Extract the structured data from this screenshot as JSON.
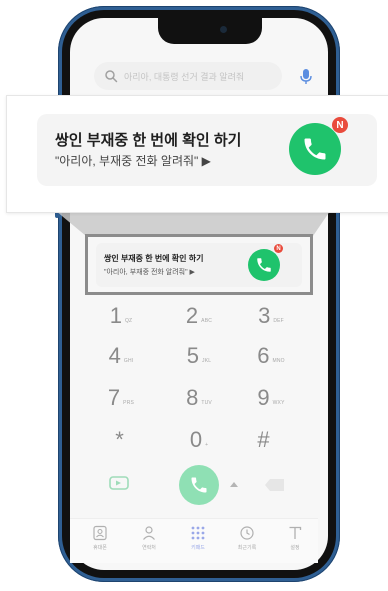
{
  "search": {
    "placeholder": "아리아, 대통령 선거 결과 알려줘"
  },
  "callout": {
    "title": "쌍인 부재중 한 번에 확인 하기",
    "subtitle": "\"아리아, 부재중 전화 알려줘\" ▶",
    "badge": "N"
  },
  "banner": {
    "title": "쌍인 부재중 한 번에 확인 하기",
    "subtitle": "\"아리아, 부재중 전화 알려줘\" ▶",
    "badge": "N"
  },
  "dialpad": {
    "keys": [
      {
        "digit": "1",
        "letters": "QZ"
      },
      {
        "digit": "2",
        "letters": "ABC"
      },
      {
        "digit": "3",
        "letters": "DEF"
      },
      {
        "digit": "4",
        "letters": "GHI"
      },
      {
        "digit": "5",
        "letters": "JKL"
      },
      {
        "digit": "6",
        "letters": "MNO"
      },
      {
        "digit": "7",
        "letters": "PRS"
      },
      {
        "digit": "8",
        "letters": "TUV"
      },
      {
        "digit": "9",
        "letters": "WXY"
      },
      {
        "digit": "*",
        "letters": ""
      },
      {
        "digit": "0",
        "letters": "+"
      },
      {
        "digit": "#",
        "letters": ""
      }
    ]
  },
  "nav": {
    "items": [
      {
        "label": "휴대폰",
        "icon": "phone-book-icon"
      },
      {
        "label": "연락처",
        "icon": "contacts-icon"
      },
      {
        "label": "키패드",
        "icon": "keypad-icon"
      },
      {
        "label": "최근기록",
        "icon": "recent-icon"
      },
      {
        "label": "설정",
        "icon": "settings-icon"
      }
    ],
    "active_index": 2
  },
  "colors": {
    "accent_green": "#1fc36c",
    "call_button_green": "#8fe0b4",
    "badge_red": "#e94b3c",
    "frame_blue": "#2f5f93",
    "nav_active": "#9aa8e8"
  }
}
